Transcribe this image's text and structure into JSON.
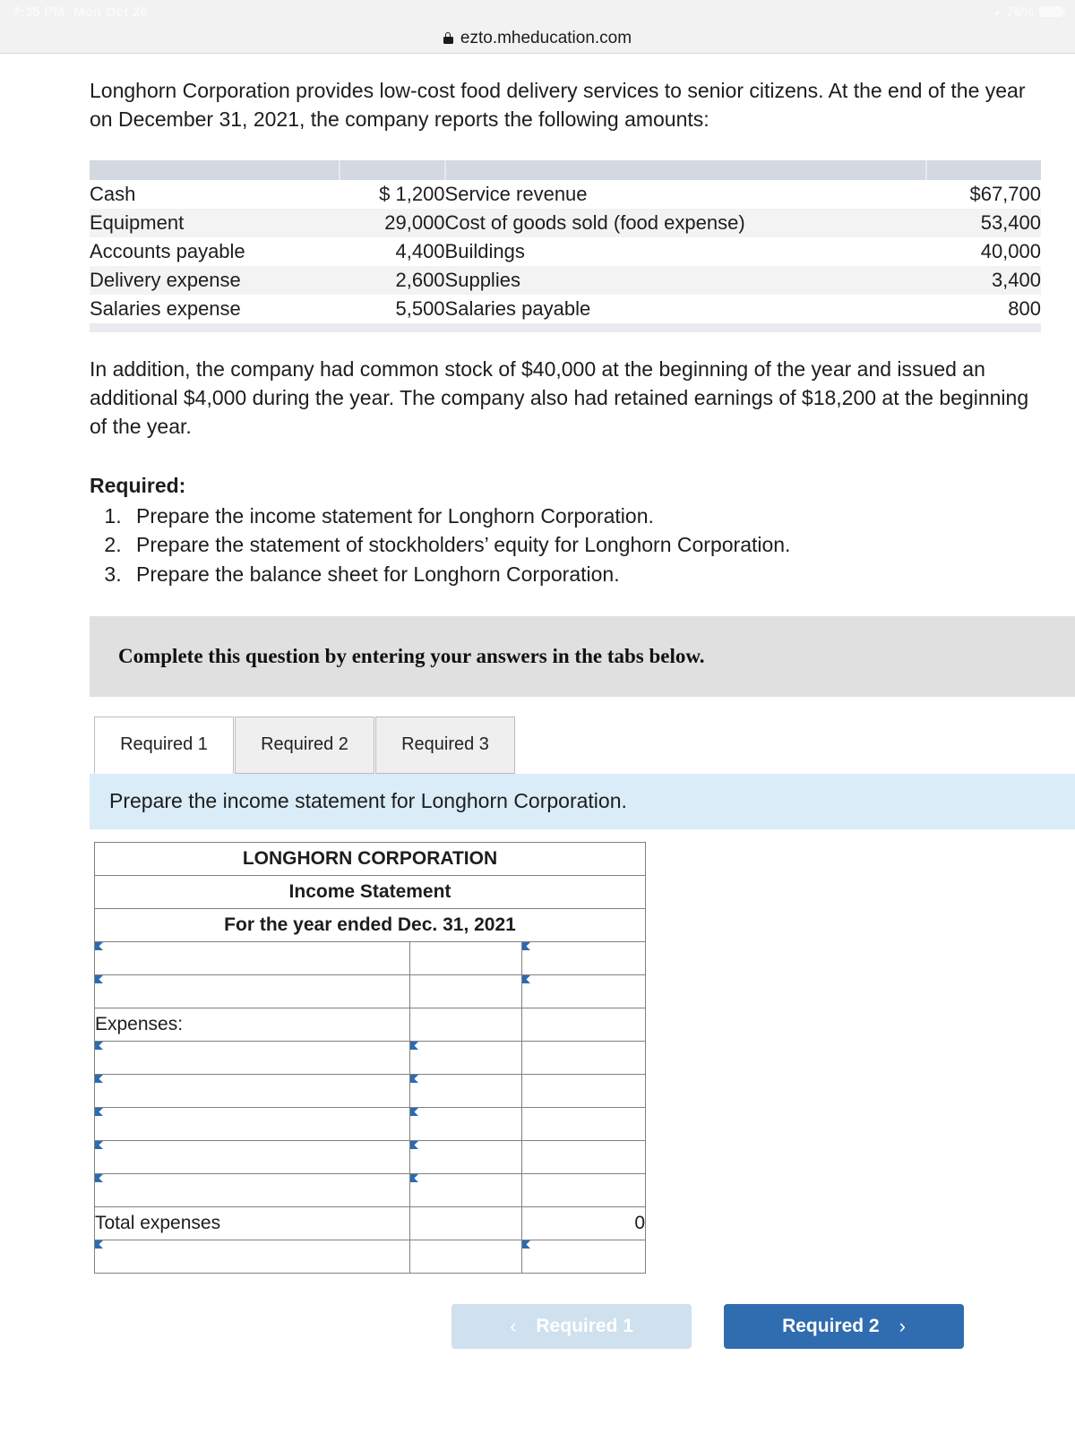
{
  "status_bar": {
    "time": "7:35 PM",
    "date": "Mon Oct 26",
    "wifi_icon": "wifi-icon",
    "battery_percent": "76%",
    "battery_icon": "battery-icon"
  },
  "browser": {
    "lock_icon": "lock-icon",
    "url": "ezto.mheducation.com"
  },
  "intro": {
    "paragraph": "Longhorn Corporation provides low-cost food delivery services to senior citizens. At the end of the year on December 31, 2021, the company reports the following amounts:"
  },
  "amounts_table": {
    "rows": [
      {
        "label_left": "Cash",
        "amount_left": "$  1,200",
        "label_right": "Service revenue",
        "amount_right": "$67,700"
      },
      {
        "label_left": "Equipment",
        "amount_left": "29,000",
        "label_right": "Cost of goods sold (food expense)",
        "amount_right": "53,400"
      },
      {
        "label_left": "Accounts payable",
        "amount_left": "4,400",
        "label_right": "Buildings",
        "amount_right": "40,000"
      },
      {
        "label_left": "Delivery expense",
        "amount_left": "2,600",
        "label_right": "Supplies",
        "amount_right": "3,400"
      },
      {
        "label_left": "Salaries expense",
        "amount_left": "5,500",
        "label_right": "Salaries payable",
        "amount_right": "800"
      }
    ]
  },
  "addendum": {
    "paragraph": "In addition, the company had common stock of $40,000 at the beginning of the year and issued an additional $4,000 during the year. The company also had retained earnings of $18,200 at the beginning of the year."
  },
  "required": {
    "title": "Required:",
    "items": [
      "Prepare the income statement for Longhorn Corporation.",
      "Prepare the statement of stockholders’ equity for Longhorn Corporation.",
      "Prepare the balance sheet for Longhorn Corporation."
    ]
  },
  "banner": {
    "text": "Complete this question by entering your answers in the tabs below."
  },
  "tabs": [
    {
      "label": "Required 1",
      "active": true
    },
    {
      "label": "Required 2",
      "active": false
    },
    {
      "label": "Required 3",
      "active": false
    }
  ],
  "prompt": {
    "text": "Prepare the income statement for Longhorn Corporation."
  },
  "worksheet": {
    "header_lines": [
      "LONGHORN CORPORATION",
      "Income Statement",
      "For the year ended Dec. 31, 2021"
    ],
    "rows": [
      {
        "label": "",
        "col2": "",
        "col3": ""
      },
      {
        "label": "",
        "col2": "",
        "col3": ""
      },
      {
        "label": "Expenses:",
        "col2": "",
        "col3": ""
      },
      {
        "label": "",
        "col2": "",
        "col3": ""
      },
      {
        "label": "",
        "col2": "",
        "col3": ""
      },
      {
        "label": "",
        "col2": "",
        "col3": ""
      },
      {
        "label": "",
        "col2": "",
        "col3": ""
      },
      {
        "label": "",
        "col2": "",
        "col3": ""
      },
      {
        "label": "Total expenses",
        "col2": "",
        "col3": "0"
      },
      {
        "label": "",
        "col2": "",
        "col3": ""
      }
    ]
  },
  "nav": {
    "prev_label": "Required 1",
    "prev_chevron": "‹",
    "next_label": "Required 2",
    "next_chevron": "›"
  },
  "colors": {
    "header_blue": "#7cade0",
    "prompt_blue": "#d9ecf7",
    "button_blue": "#2f6cb0",
    "button_disabled_blue": "#cfe0ee",
    "banner_gray": "#e0e0e0",
    "amounts_header_gray": "#d4d8e1",
    "input_border_blue": "#6d93b8",
    "marker_blue": "#2b6cb0"
  }
}
